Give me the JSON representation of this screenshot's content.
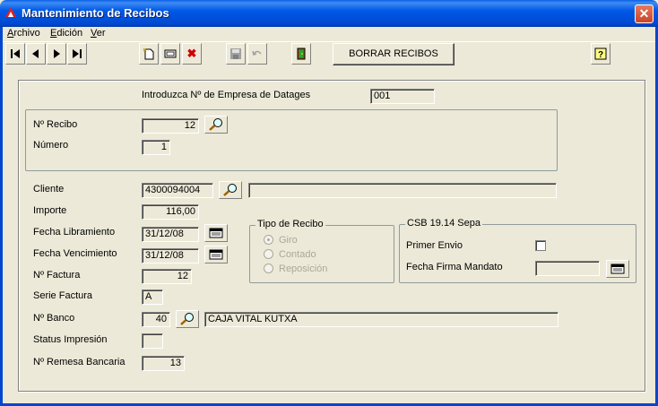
{
  "window": {
    "title": "Mantenimiento de Recibos",
    "close_glyph": "✕"
  },
  "menu": [
    {
      "label": "Archivo",
      "accel": "A"
    },
    {
      "label": "Edición",
      "accel": "E"
    },
    {
      "label": "Ver",
      "accel": "V"
    }
  ],
  "toolbar": {
    "first": "⏮",
    "prev": "◀",
    "next": "▶",
    "last": "⏭",
    "delete": "✖",
    "borrar_label": "BORRAR RECIBOS"
  },
  "empresa": {
    "label": "Introduzca Nº de Empresa de Datages",
    "value": "001"
  },
  "recibo": {
    "label": "Nº Recibo",
    "value": "12"
  },
  "numero": {
    "label": "Número",
    "value": "1"
  },
  "cliente": {
    "label": "Cliente",
    "code": "4300094004",
    "name": ""
  },
  "importe": {
    "label": "Importe",
    "value": "116,00"
  },
  "fecha_libramiento": {
    "label": "Fecha Libramiento",
    "value": "31/12/08"
  },
  "fecha_vencimiento": {
    "label": "Fecha Vencimiento",
    "value": "31/12/08"
  },
  "factura": {
    "label": "Nº Factura",
    "value": "12"
  },
  "serie": {
    "label": "Serie Factura",
    "value": "A"
  },
  "banco": {
    "label": "Nº Banco",
    "code": "40",
    "name": "CAJA VITAL KUTXA"
  },
  "status": {
    "label": "Status Impresión",
    "value": ""
  },
  "remesa": {
    "label": "Nº Remesa Bancaria",
    "value": "13"
  },
  "tipo_recibo": {
    "legend": "Tipo de Recibo",
    "options": [
      "Giro",
      "Contado",
      "Reposición"
    ],
    "selected": "Giro"
  },
  "sepa": {
    "legend": "CSB 19.14 Sepa",
    "primer_envio_label": "Primer Envio",
    "primer_envio_checked": false,
    "fecha_firma_label": "Fecha Firma Mandato",
    "fecha_firma_value": ""
  }
}
